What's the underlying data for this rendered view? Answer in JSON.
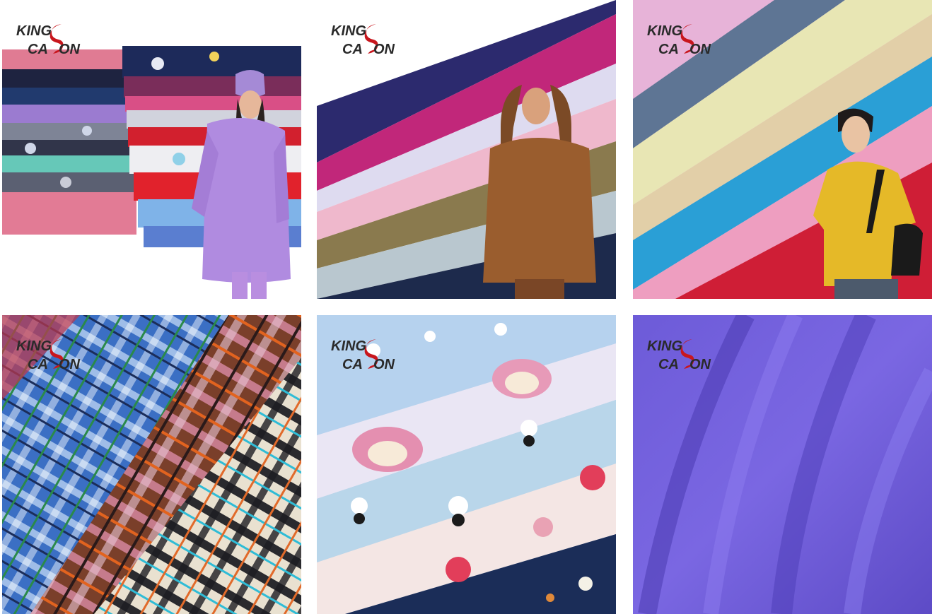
{
  "brand": {
    "line1": "KING",
    "line2": "CA",
    "line2_end": "ON"
  },
  "colors": {
    "brand_red": "#c8161d",
    "brand_dark": "#2a2a2a",
    "background": "#ffffff"
  },
  "tiles": [
    {
      "subject": "stacked printed and solid polar fleece folds with woman in lilac hoodie",
      "icon": "fabric-stack-photo"
    },
    {
      "subject": "diagonal layers of solid fleece with woman in brown zip hoodie",
      "icon": "fabric-layers-photo"
    },
    {
      "subject": "diagonal pastel fleece layers with man in yellow pullover",
      "icon": "fabric-layers-photo"
    },
    {
      "subject": "plaid brushed fleece swatches",
      "icon": "plaid-fabric-photo"
    },
    {
      "subject": "cartoon printed fleece swatches",
      "icon": "printed-fabric-photo"
    },
    {
      "subject": "purple solid fleece drape close-up",
      "icon": "solid-fabric-photo"
    }
  ]
}
